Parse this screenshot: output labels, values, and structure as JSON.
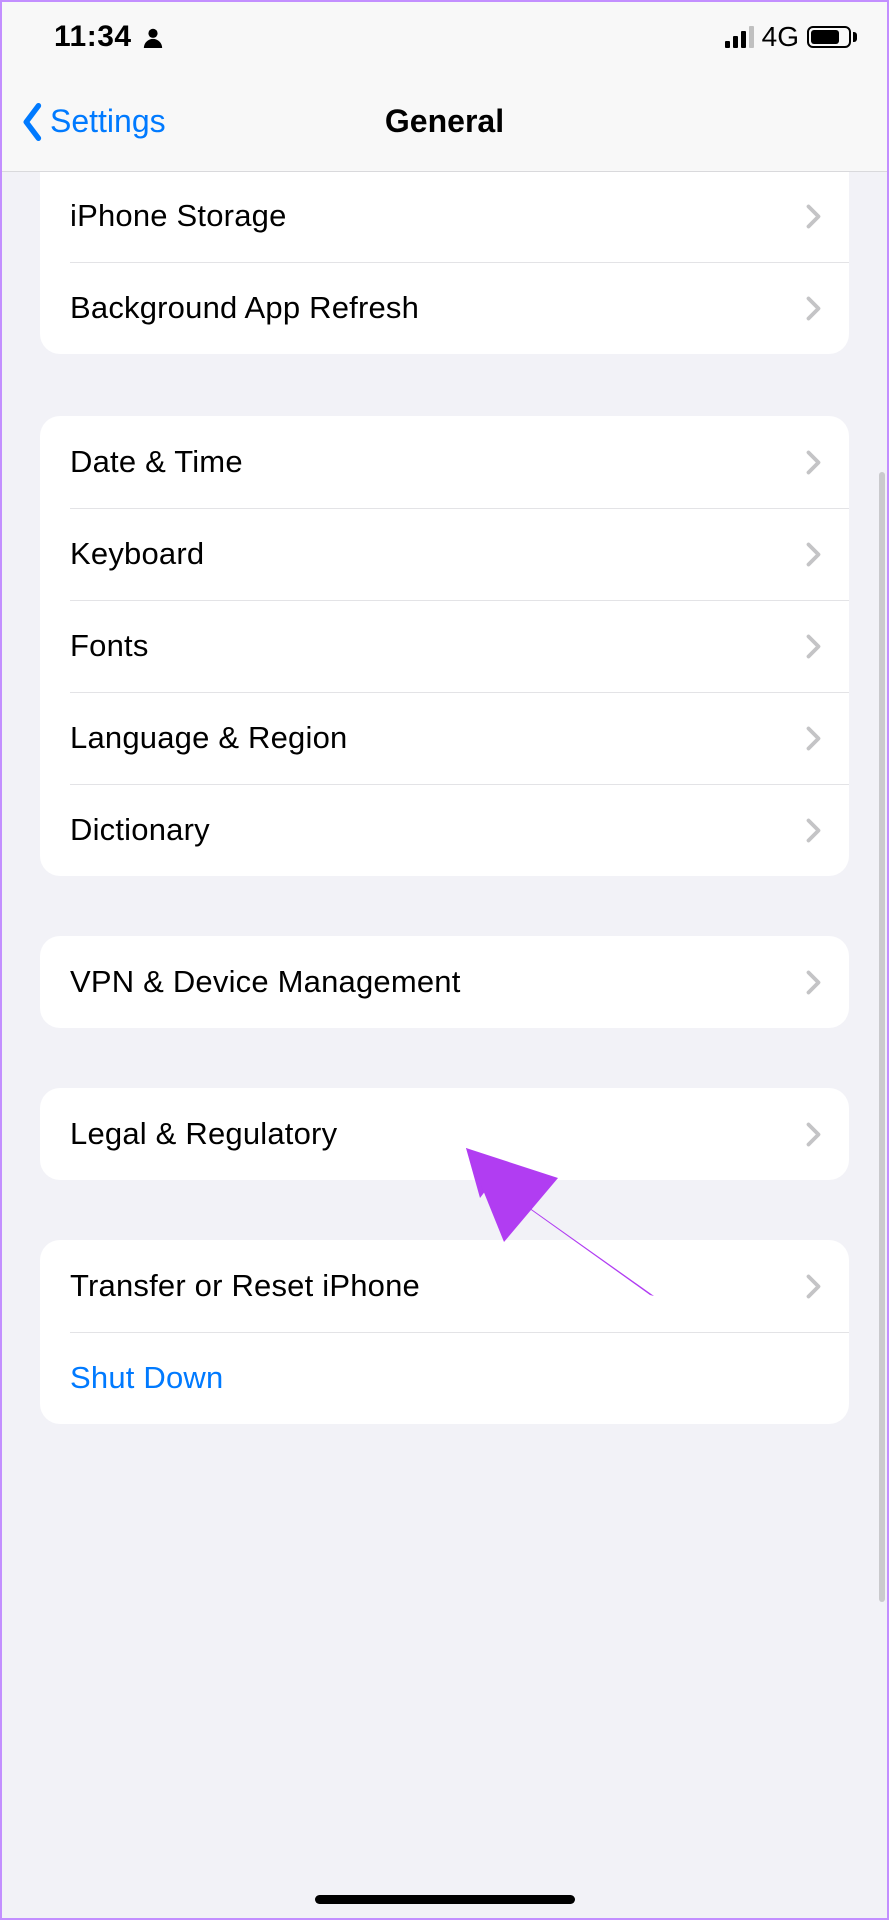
{
  "statusbar": {
    "time": "11:34",
    "network": "4G"
  },
  "nav": {
    "back": "Settings",
    "title": "General"
  },
  "groups": [
    {
      "items": [
        {
          "key": "iphone-storage",
          "label": "iPhone Storage",
          "chevron": true
        },
        {
          "key": "background-app-refresh",
          "label": "Background App Refresh",
          "chevron": true
        }
      ]
    },
    {
      "items": [
        {
          "key": "date-time",
          "label": "Date & Time",
          "chevron": true
        },
        {
          "key": "keyboard",
          "label": "Keyboard",
          "chevron": true
        },
        {
          "key": "fonts",
          "label": "Fonts",
          "chevron": true
        },
        {
          "key": "language-region",
          "label": "Language & Region",
          "chevron": true
        },
        {
          "key": "dictionary",
          "label": "Dictionary",
          "chevron": true
        }
      ]
    },
    {
      "items": [
        {
          "key": "vpn-device-management",
          "label": "VPN & Device Management",
          "chevron": true
        }
      ]
    },
    {
      "items": [
        {
          "key": "legal-regulatory",
          "label": "Legal & Regulatory",
          "chevron": true
        }
      ]
    },
    {
      "items": [
        {
          "key": "transfer-reset",
          "label": "Transfer or Reset iPhone",
          "chevron": true
        },
        {
          "key": "shut-down",
          "label": "Shut Down",
          "chevron": false,
          "link": true
        }
      ]
    }
  ],
  "annotation": {
    "target": "vpn-device-management",
    "color": "#b13df2"
  }
}
